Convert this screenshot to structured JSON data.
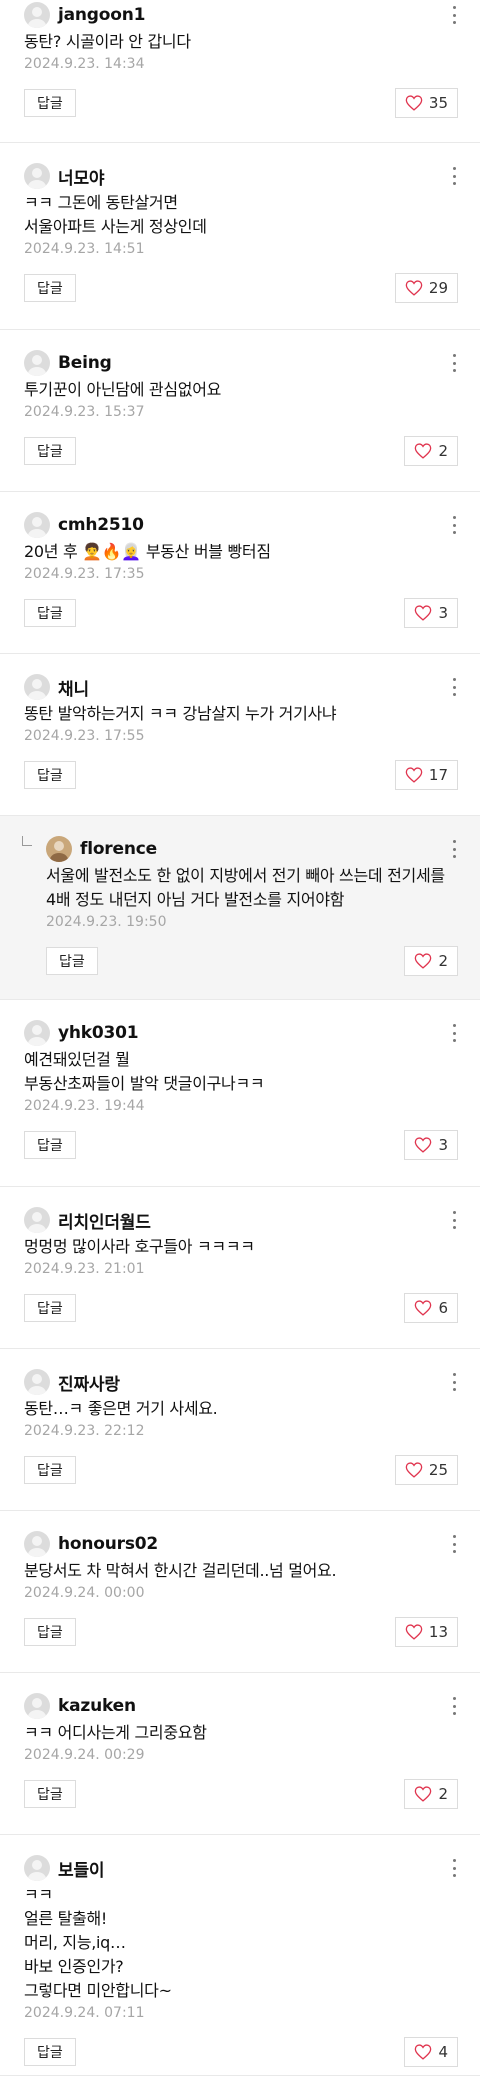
{
  "reply_label": "답글",
  "comments": [
    {
      "user": "jangoon1",
      "text": "동탄? 시골이라 안 갑니다",
      "date": "2024.9.23. 14:34",
      "likes": "35"
    },
    {
      "user": "너모야",
      "text": "ㅋㅋ 그돈에 동탄살거면\n서울아파트 사는게 정상인데",
      "date": "2024.9.23. 14:51",
      "likes": "29"
    },
    {
      "user": "Being",
      "text": "투기꾼이 아닌담에 관심없어요",
      "date": "2024.9.23. 15:37",
      "likes": "2"
    },
    {
      "user": "cmh2510",
      "text": "20년 후 🧑‍🦱🔥👩‍🦳 부동산 버블 빵터짐",
      "date": "2024.9.23. 17:35",
      "likes": "3"
    },
    {
      "user": "채니",
      "text": "똥탄 발악하는거지 ㅋㅋ 강남살지 누가 거기사냐",
      "date": "2024.9.23. 17:55",
      "likes": "17"
    },
    {
      "user": "florence",
      "text": "서울에 발전소도 한 없이 지방에서 전기 빼아 쓰는데 전기세를 4배 정도 내던지 아님 거다 발전소를 지어야함",
      "date": "2024.9.23. 19:50",
      "likes": "2",
      "reply": true
    },
    {
      "user": "yhk0301",
      "text": "예견돼있던걸 뭘\n부동산초짜들이 발악 댓글이구나ㅋㅋ",
      "date": "2024.9.23. 19:44",
      "likes": "3"
    },
    {
      "user": "리치인더월드",
      "text": "멍멍멍 많이사라 호구들아 ㅋㅋㅋㅋ",
      "date": "2024.9.23. 21:01",
      "likes": "6"
    },
    {
      "user": "진짜사랑",
      "text": "동탄…ㅋ 좋은면 거기 사세요.",
      "date": "2024.9.23. 22:12",
      "likes": "25"
    },
    {
      "user": "honours02",
      "text": "분당서도 차 막혀서 한시간 걸리던데..넘 멀어요.",
      "date": "2024.9.24. 00:00",
      "likes": "13"
    },
    {
      "user": "kazuken",
      "text": "ㅋㅋ 어디사는게 그리중요함",
      "date": "2024.9.24. 00:29",
      "likes": "2"
    },
    {
      "user": "보들이",
      "text": "ㅋㅋ\n얼른 탈출해!\n머리, 지능,iq…\n바보 인증인가?\n그렇다면 미안합니다~",
      "date": "2024.9.24. 07:11",
      "likes": "4"
    }
  ]
}
